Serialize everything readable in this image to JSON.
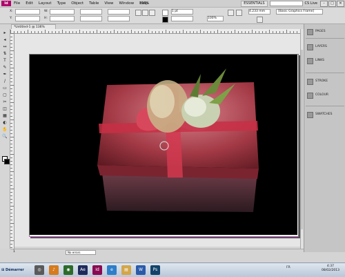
{
  "menubar": {
    "app_logo": "Id",
    "items": [
      "File",
      "Edit",
      "Layout",
      "Type",
      "Object",
      "Table",
      "View",
      "Window",
      "Help"
    ],
    "zoom": "136%",
    "workspace": "ESSENTIALS",
    "cs_live": "CS Live",
    "window_buttons": [
      "–",
      "□",
      "✕"
    ]
  },
  "control": {
    "x_label": "X:",
    "y_label": "Y:",
    "w_label": "W:",
    "h_label": "H:",
    "stroke_weight": "1 pt",
    "zoom_pct": "100%",
    "offset": "4.233 mm",
    "frame_style": "[Basic Graphics Frame]"
  },
  "document": {
    "tab_title": "*Untitled-1 @ 136%"
  },
  "tools": [
    "▸",
    "◂",
    "↔",
    "⇅",
    "T",
    "✎",
    "✒",
    "/",
    "▭",
    "▢",
    "✂",
    "◫",
    "▦",
    "◐",
    "✋",
    "🔍"
  ],
  "status": {
    "page": "1",
    "preflight": "No errors"
  },
  "panels": {
    "items": [
      {
        "label": "PAGES",
        "icon": "pages-icon"
      },
      {
        "label": "LAYERS",
        "icon": "layers-icon"
      },
      {
        "label": "LINKS",
        "icon": "links-icon"
      },
      {
        "label": "STROKE",
        "icon": "stroke-icon"
      },
      {
        "label": "COLOUR",
        "icon": "colour-icon"
      },
      {
        "label": "SWATCHES",
        "icon": "swatches-icon"
      }
    ]
  },
  "taskbar": {
    "start_label": "Démarrer",
    "apps": [
      {
        "label": "◎",
        "color": "#5a5a5a"
      },
      {
        "label": "♪",
        "color": "#d67b1e"
      },
      {
        "label": "◉",
        "color": "#2d6b2a"
      },
      {
        "label": "Ae",
        "color": "#1f2a5c"
      },
      {
        "label": "Id",
        "color": "#8a0a52"
      },
      {
        "label": "e",
        "color": "#2f7ec8"
      },
      {
        "label": "▤",
        "color": "#d3a64a"
      },
      {
        "label": "W",
        "color": "#2b5aa8"
      },
      {
        "label": "Ps",
        "color": "#14436a"
      }
    ],
    "tray_lang": "FR",
    "time": "4:37",
    "date": "08/02/2013"
  }
}
